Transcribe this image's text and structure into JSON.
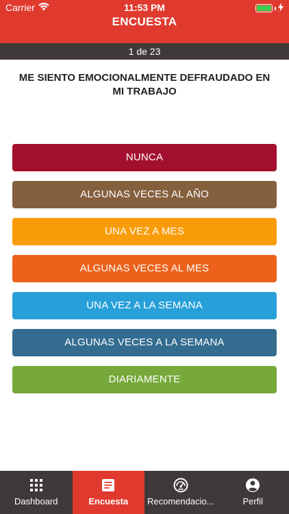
{
  "status_bar": {
    "carrier": "Carrier",
    "time": "11:53 PM"
  },
  "header": {
    "title": "ENCUESTA"
  },
  "progress": {
    "label": "1 de 23",
    "current": 1,
    "total": 23
  },
  "question": {
    "text": "ME SIENTO EMOCIONALMENTE DEFRAUDADO EN MI TRABAJO"
  },
  "options": [
    {
      "label": "NUNCA",
      "color": "#a3102f"
    },
    {
      "label": "ALGUNAS VECES AL AÑO",
      "color": "#85603e"
    },
    {
      "label": "UNA VEZ A MES",
      "color": "#f89c09"
    },
    {
      "label": "ALGUNAS VECES AL MES",
      "color": "#ec621b"
    },
    {
      "label": "UNA VEZ A LA SEMANA",
      "color": "#27a0d9"
    },
    {
      "label": "ALGUNAS VECES A LA SEMANA",
      "color": "#346c90"
    },
    {
      "label": "DIARIAMENTE",
      "color": "#77a83a"
    }
  ],
  "tabbar": {
    "tabs": [
      {
        "label": "Dashboard",
        "icon": "grid-icon"
      },
      {
        "label": "Encuesta",
        "icon": "document-icon",
        "active": true
      },
      {
        "label": "Recomendacio...",
        "icon": "speedometer-icon"
      },
      {
        "label": "Perfil",
        "icon": "user-circle-icon"
      }
    ]
  },
  "colors": {
    "brand_red": "#e03a2f",
    "dark_bar": "#3f3a39",
    "battery_green": "#3ccf4e"
  }
}
